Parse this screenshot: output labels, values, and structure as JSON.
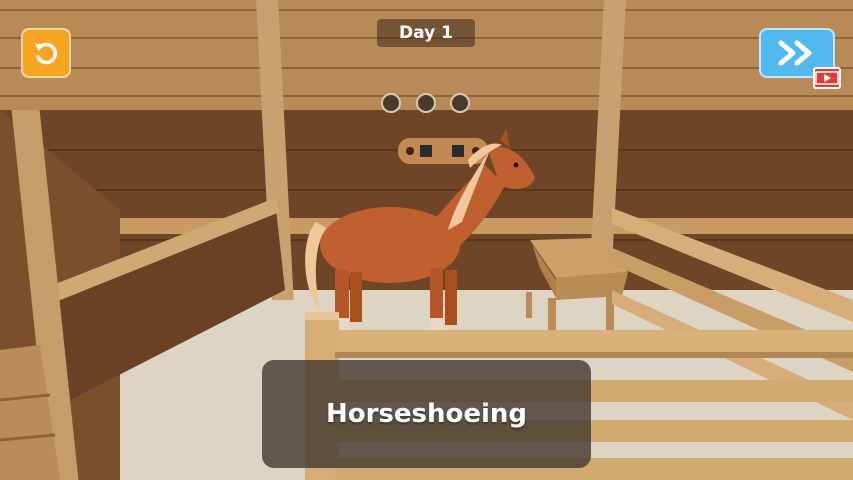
{
  "hud": {
    "day_label": "Day 1",
    "progress_dots": 3,
    "progress_completed": 0,
    "restart_icon": "restart-icon",
    "skip_icon": "fast-forward-icon",
    "video_ad_icon": "video-ad-icon"
  },
  "caption": {
    "text": "Horseshoeing"
  },
  "colors": {
    "restart_button": "#f6a422",
    "skip_button": "#52b9ee",
    "video_badge": "#e53935",
    "horse_coat": "#c0602e",
    "horse_mane": "#efc79a"
  }
}
